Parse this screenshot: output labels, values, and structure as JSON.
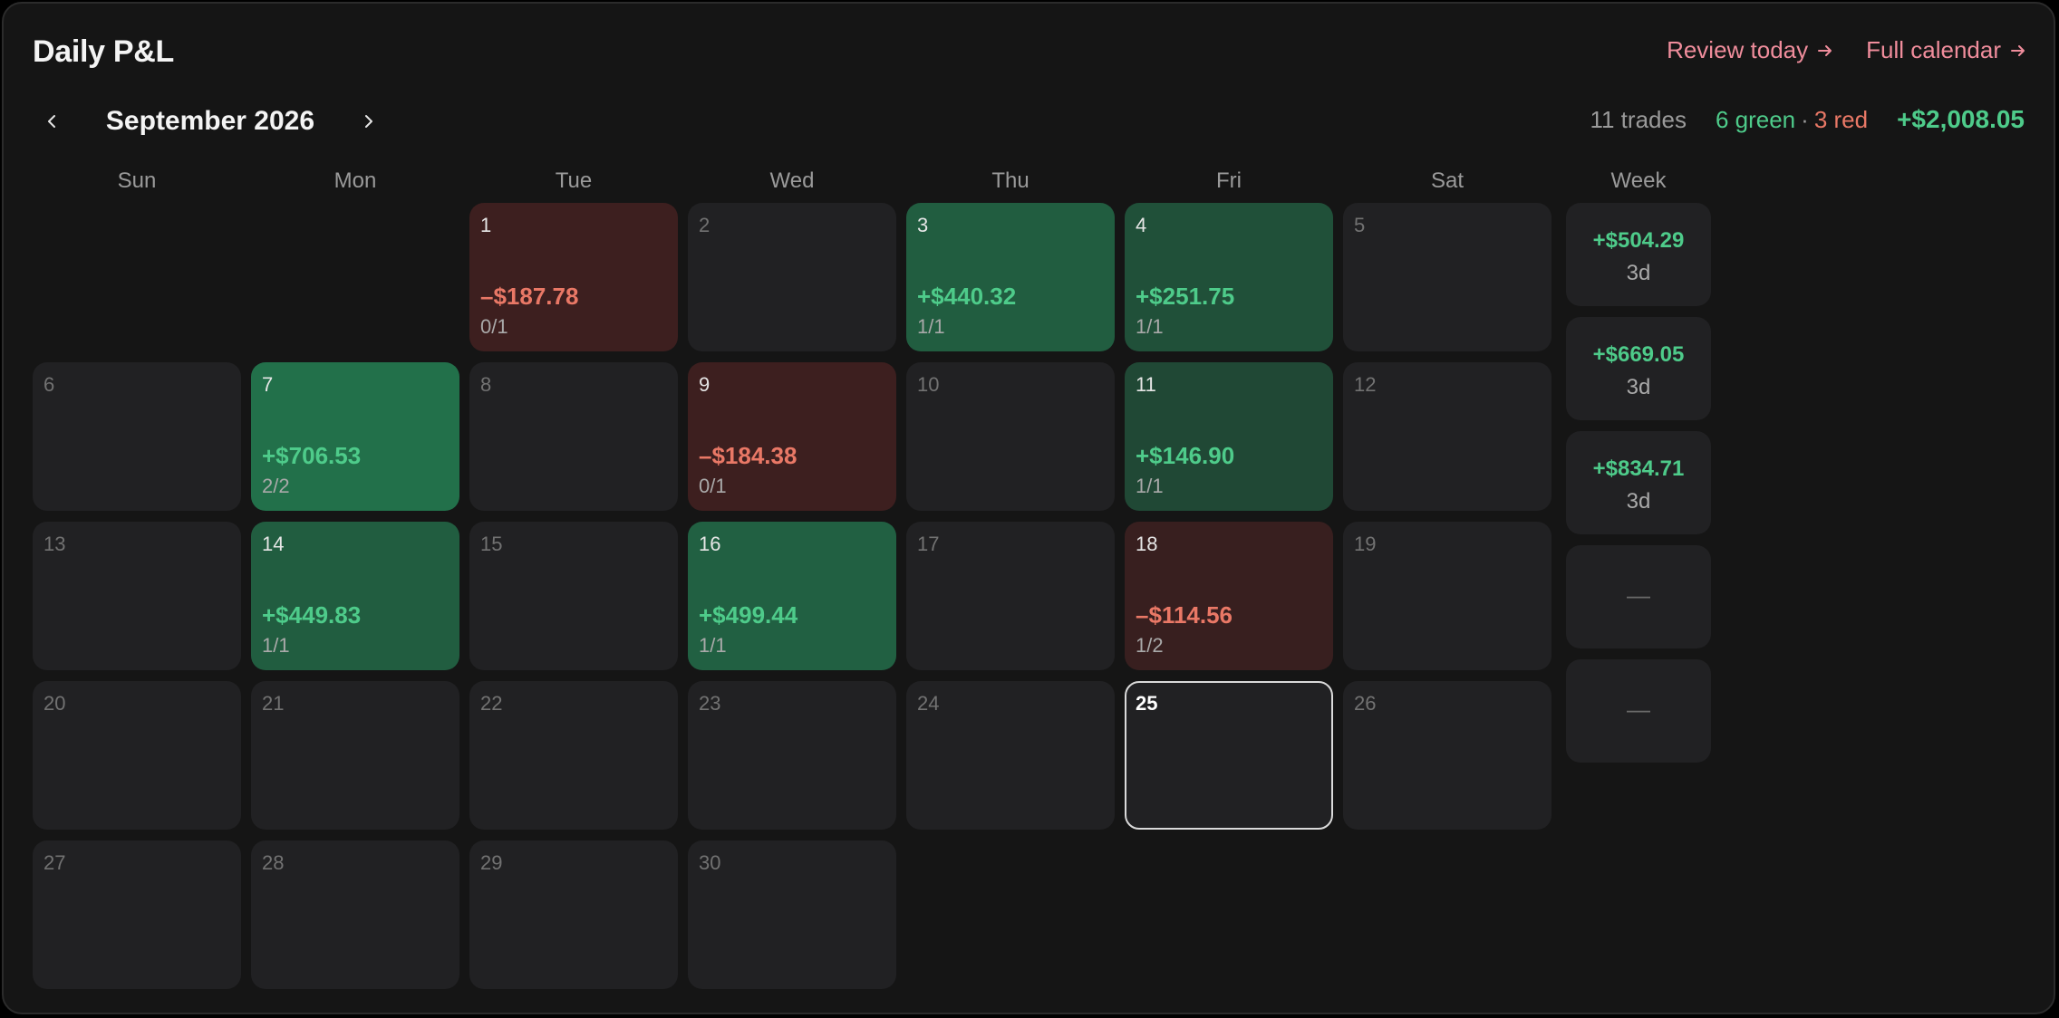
{
  "header": {
    "title": "Daily P&L",
    "links": [
      {
        "label": "Review today"
      },
      {
        "label": "Full calendar"
      }
    ]
  },
  "nav": {
    "month_label": "September 2026"
  },
  "summary": {
    "trades": "11 trades",
    "green": "6 green",
    "separator": "·",
    "red": "3 red",
    "total": "+$2,008.05"
  },
  "weekdays": [
    "Sun",
    "Mon",
    "Tue",
    "Wed",
    "Thu",
    "Fri",
    "Sat"
  ],
  "week_header": "Week",
  "colors": {
    "positive": "#4ecb8a",
    "negative": "#e97866",
    "accent_link": "#f08d9c",
    "empty_cell": "#212123",
    "today_border": "#dadada"
  },
  "month": {
    "first_weekday": 2,
    "days_in_month": 30,
    "today": 25
  },
  "days": [
    {
      "day": 1,
      "pnl": "–$187.78",
      "ratio": "0/1",
      "direction": "loss",
      "intensity": 0.5
    },
    {
      "day": 3,
      "pnl": "+$440.32",
      "ratio": "1/1",
      "direction": "profit",
      "intensity": 0.65
    },
    {
      "day": 4,
      "pnl": "+$251.75",
      "ratio": "1/1",
      "direction": "profit",
      "intensity": 0.4
    },
    {
      "day": 7,
      "pnl": "+$706.53",
      "ratio": "2/2",
      "direction": "profit",
      "intensity": 1.0
    },
    {
      "day": 9,
      "pnl": "–$184.38",
      "ratio": "0/1",
      "direction": "loss",
      "intensity": 0.5
    },
    {
      "day": 11,
      "pnl": "+$146.90",
      "ratio": "1/1",
      "direction": "profit",
      "intensity": 0.25
    },
    {
      "day": 14,
      "pnl": "+$449.83",
      "ratio": "1/1",
      "direction": "profit",
      "intensity": 0.65
    },
    {
      "day": 16,
      "pnl": "+$499.44",
      "ratio": "1/1",
      "direction": "profit",
      "intensity": 0.7
    },
    {
      "day": 18,
      "pnl": "–$114.56",
      "ratio": "1/2",
      "direction": "loss",
      "intensity": 0.35
    }
  ],
  "weeks": [
    {
      "pnl": "+$504.29",
      "days": "3d"
    },
    {
      "pnl": "+$669.05",
      "days": "3d"
    },
    {
      "pnl": "+$834.71",
      "days": "3d"
    },
    {
      "pnl": "",
      "days": "",
      "empty": "—"
    },
    {
      "pnl": "",
      "days": "",
      "empty": "—"
    }
  ]
}
